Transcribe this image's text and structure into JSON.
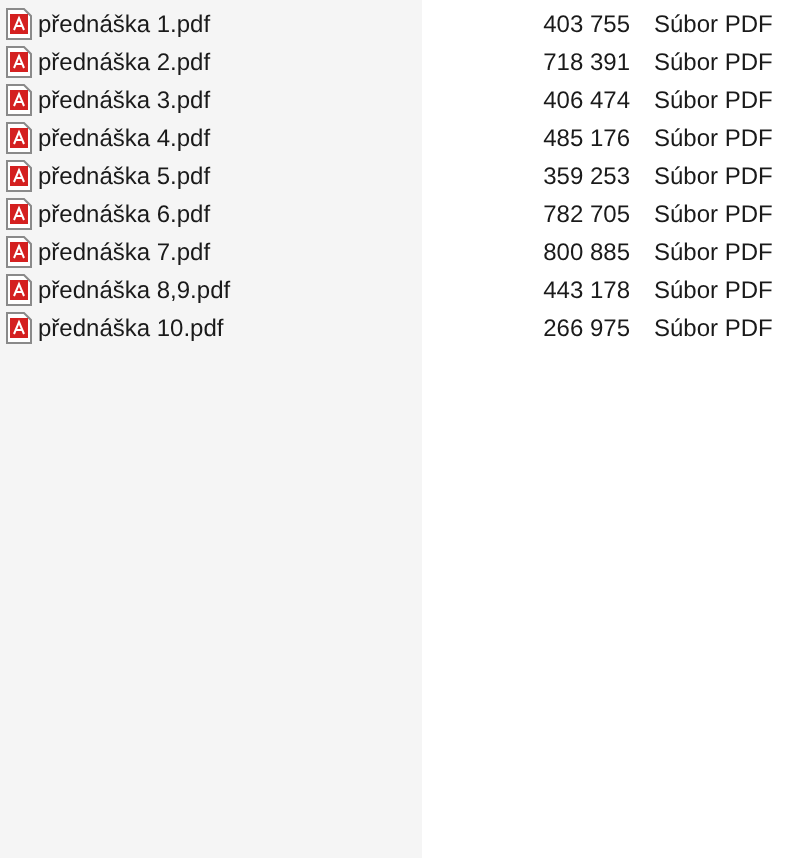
{
  "files": [
    {
      "name": "přednáška 1.pdf",
      "size": "403 755",
      "type": "Súbor PDF"
    },
    {
      "name": "přednáška 2.pdf",
      "size": "718 391",
      "type": "Súbor PDF"
    },
    {
      "name": "přednáška 3.pdf",
      "size": "406 474",
      "type": "Súbor PDF"
    },
    {
      "name": "přednáška 4.pdf",
      "size": "485 176",
      "type": "Súbor PDF"
    },
    {
      "name": "přednáška 5.pdf",
      "size": "359 253",
      "type": "Súbor PDF"
    },
    {
      "name": "přednáška 6.pdf",
      "size": "782 705",
      "type": "Súbor PDF"
    },
    {
      "name": "přednáška 7.pdf",
      "size": "800 885",
      "type": "Súbor PDF"
    },
    {
      "name": "přednáška 8,9.pdf",
      "size": "443 178",
      "type": "Súbor PDF"
    },
    {
      "name": "přednáška 10.pdf",
      "size": "266 975",
      "type": "Súbor PDF"
    }
  ]
}
